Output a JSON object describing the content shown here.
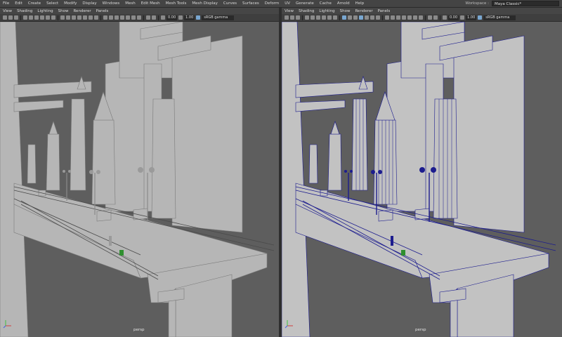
{
  "menu": [
    "File",
    "Edit",
    "Create",
    "Select",
    "Modify",
    "Display",
    "Windows",
    "Mesh",
    "Edit Mesh",
    "Mesh Tools",
    "Mesh Display",
    "Curves",
    "Surfaces",
    "Deform",
    "UV",
    "Generate",
    "Cache",
    "Arnold",
    "Help"
  ],
  "workspace": {
    "label": "Workspace :",
    "value": "Maya Classic*"
  },
  "left_panel": {
    "menu": [
      "View",
      "Shading",
      "Lighting",
      "Show",
      "Renderer",
      "Panels"
    ],
    "toolbar": {
      "exposure": "0.00",
      "gamma": "1.00",
      "color_space": "sRGB gamma"
    },
    "camera": "persp"
  },
  "right_panel": {
    "menu": [
      "View",
      "Shading",
      "Lighting",
      "Show",
      "Renderer",
      "Panels"
    ],
    "toolbar": {
      "exposure": "0.00",
      "gamma": "1.00",
      "color_space": "sRGB gamma"
    },
    "camera": "persp"
  },
  "colors": {
    "wireframe": "#1c1c8e",
    "background": "#5e5e5e",
    "geometry": "#b7b7b7"
  },
  "icons": {
    "axis_gizmo": "axis-gizmo-icon",
    "toolbar_buttons": "viewport-tool-icon"
  }
}
